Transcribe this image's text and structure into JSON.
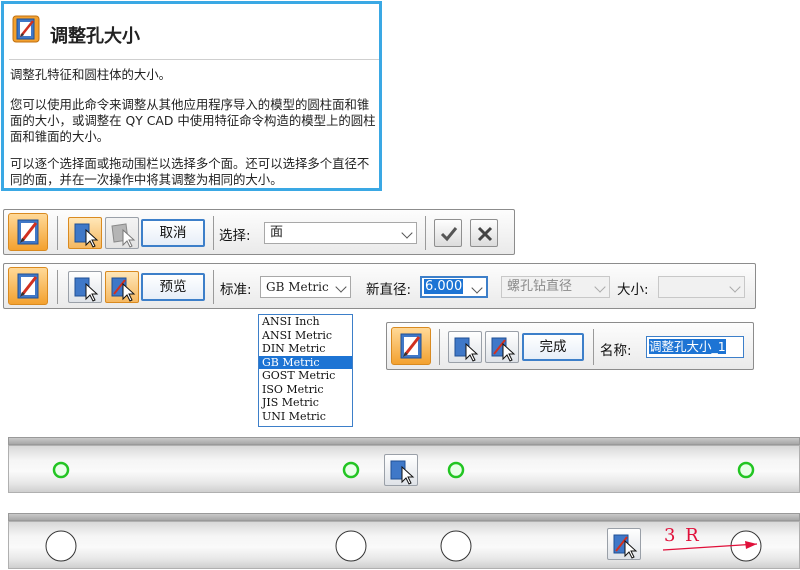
{
  "help": {
    "title": "调整孔大小",
    "p1": "调整孔特征和圆柱体的大小。",
    "p2": "您可以使用此命令来调整从其他应用程序导入的模型的圆柱面和锥面的大小，或调整在 QY CAD 中使用特征命令构造的模型上的圆柱面和锥面的大小。",
    "p3": "可以逐个选择面或拖动围栏以选择多个面。还可以选择多个直径不同的面，并在一次操作中将其调整为相同的大小。"
  },
  "bar1": {
    "cancel_label": "取消",
    "select_label": "选择:",
    "select_value": "面"
  },
  "bar2": {
    "preview_label": "预览",
    "standard_label": "标准:",
    "standard_value": "GB Metric",
    "new_diameter_label": "新直径:",
    "new_diameter_value": "6.000",
    "thread_value": "螺孔钻直径",
    "size_label": "大小:",
    "size_value": ""
  },
  "standard_options": [
    "ANSI Inch",
    "ANSI Metric",
    "DIN Metric",
    "GB Metric",
    "GOST Metric",
    "ISO Metric",
    "JIS Metric",
    "UNI Metric"
  ],
  "standard_selected_index": 3,
  "bar3": {
    "finish_label": "完成",
    "name_label": "名称:",
    "name_value": "调整孔大小_1"
  },
  "annotation": {
    "radius_label": "3 R"
  },
  "colors": {
    "accent_blue": "#3d7fc9",
    "help_border": "#3aa8e4",
    "selection_green": "#22c522",
    "dimension_red": "#e0103a",
    "icon_orange": "#f3a12f"
  }
}
